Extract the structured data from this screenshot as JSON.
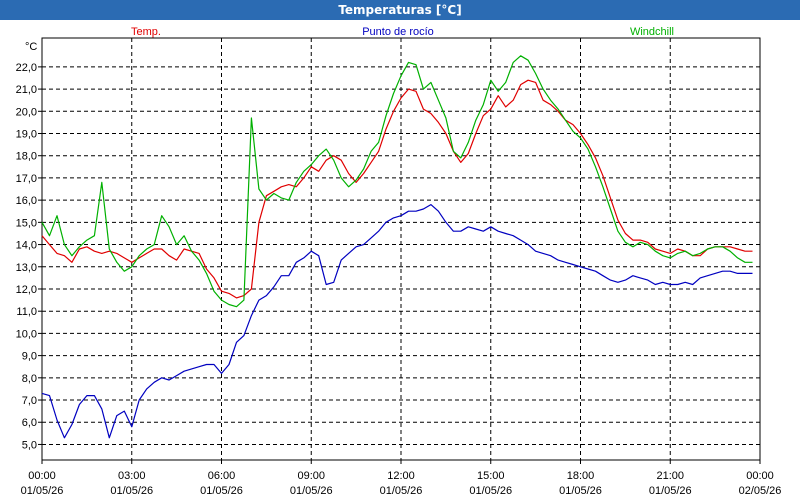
{
  "window": {
    "title": "Temperaturas [°C]"
  },
  "chart_data": {
    "type": "line",
    "title": "Temperaturas [°C]",
    "ylabel": "°C",
    "ylim": [
      4.3,
      23.3
    ],
    "yticks": [
      5.0,
      6.0,
      7.0,
      8.0,
      9.0,
      10.0,
      11.0,
      12.0,
      13.0,
      14.0,
      15.0,
      16.0,
      17.0,
      18.0,
      19.0,
      20.0,
      21.0,
      22.0
    ],
    "ytick_labels": [
      "5,0",
      "6,0",
      "7,0",
      "8,0",
      "9,0",
      "10,0",
      "11,0",
      "12,0",
      "13,0",
      "14,0",
      "15,0",
      "16,0",
      "17,0",
      "18,0",
      "19,0",
      "20,0",
      "21,0",
      "22,0"
    ],
    "xlim": [
      0,
      24
    ],
    "xticks": [
      0,
      3,
      6,
      9,
      12,
      15,
      18,
      21,
      24
    ],
    "xtick_labels": [
      {
        "time": "00:00",
        "date": "01/05/26"
      },
      {
        "time": "03:00",
        "date": "01/05/26"
      },
      {
        "time": "06:00",
        "date": "01/05/26"
      },
      {
        "time": "09:00",
        "date": "01/05/26"
      },
      {
        "time": "12:00",
        "date": "01/05/26"
      },
      {
        "time": "15:00",
        "date": "01/05/26"
      },
      {
        "time": "18:00",
        "date": "01/05/26"
      },
      {
        "time": "21:00",
        "date": "01/05/26"
      },
      {
        "time": "00:00",
        "date": "02/05/26"
      }
    ],
    "grid": true,
    "legend": "top",
    "series": [
      {
        "name": "Temp.",
        "color": "#e00000",
        "x": [
          0,
          0.25,
          0.5,
          0.75,
          1,
          1.25,
          1.5,
          1.75,
          2,
          2.25,
          2.5,
          2.75,
          3,
          3.25,
          3.5,
          3.75,
          4,
          4.25,
          4.5,
          4.75,
          5,
          5.25,
          5.5,
          5.75,
          6,
          6.25,
          6.5,
          6.75,
          7,
          7.25,
          7.5,
          7.75,
          8,
          8.25,
          8.5,
          8.75,
          9,
          9.25,
          9.5,
          9.75,
          10,
          10.25,
          10.5,
          10.75,
          11,
          11.25,
          11.5,
          11.75,
          12,
          12.25,
          12.5,
          12.75,
          13,
          13.25,
          13.5,
          13.75,
          14,
          14.25,
          14.5,
          14.75,
          15,
          15.25,
          15.5,
          15.75,
          16,
          16.25,
          16.5,
          16.75,
          17,
          17.25,
          17.5,
          17.75,
          18,
          18.25,
          18.5,
          18.75,
          19,
          19.25,
          19.5,
          19.75,
          20,
          20.25,
          20.5,
          20.75,
          21,
          21.25,
          21.5,
          21.75,
          22,
          22.25,
          22.5,
          22.75,
          23,
          23.25,
          23.5,
          23.75
        ],
        "y": [
          14.4,
          14.0,
          13.6,
          13.5,
          13.2,
          13.8,
          13.9,
          13.7,
          13.6,
          13.7,
          13.6,
          13.4,
          13.2,
          13.4,
          13.6,
          13.8,
          13.8,
          13.5,
          13.3,
          13.8,
          13.7,
          13.6,
          12.9,
          12.5,
          11.9,
          11.8,
          11.6,
          11.7,
          12.0,
          15.0,
          16.2,
          16.4,
          16.6,
          16.7,
          16.6,
          17.0,
          17.5,
          17.3,
          17.8,
          18.0,
          17.8,
          17.2,
          16.8,
          17.2,
          17.7,
          18.2,
          19.2,
          20.0,
          20.6,
          21.0,
          20.9,
          20.1,
          19.9,
          19.5,
          19.0,
          18.2,
          17.7,
          18.1,
          19.0,
          19.8,
          20.1,
          20.7,
          20.2,
          20.5,
          21.2,
          21.4,
          21.3,
          20.5,
          20.3,
          20.0,
          19.6,
          19.4,
          19.0,
          18.5,
          17.9,
          17.1,
          16.1,
          15.1,
          14.5,
          14.2,
          14.2,
          14.1,
          13.8,
          13.7,
          13.6,
          13.8,
          13.7,
          13.5,
          13.5,
          13.8,
          13.9,
          13.9,
          13.9,
          13.8,
          13.7,
          13.7
        ]
      },
      {
        "name": "Punto de rocío",
        "color": "#0000c0",
        "x": [
          0,
          0.25,
          0.5,
          0.75,
          1,
          1.25,
          1.5,
          1.75,
          2,
          2.25,
          2.5,
          2.75,
          3,
          3.25,
          3.5,
          3.75,
          4,
          4.25,
          4.5,
          4.75,
          5,
          5.25,
          5.5,
          5.75,
          6,
          6.25,
          6.5,
          6.75,
          7,
          7.25,
          7.5,
          7.75,
          8,
          8.25,
          8.5,
          8.75,
          9,
          9.25,
          9.5,
          9.75,
          10,
          10.25,
          10.5,
          10.75,
          11,
          11.25,
          11.5,
          11.75,
          12,
          12.25,
          12.5,
          12.75,
          13,
          13.25,
          13.5,
          13.75,
          14,
          14.25,
          14.5,
          14.75,
          15,
          15.25,
          15.5,
          15.75,
          16,
          16.25,
          16.5,
          16.75,
          17,
          17.25,
          17.5,
          17.75,
          18,
          18.25,
          18.5,
          18.75,
          19,
          19.25,
          19.5,
          19.75,
          20,
          20.25,
          20.5,
          20.75,
          21,
          21.25,
          21.5,
          21.75,
          22,
          22.25,
          22.5,
          22.75,
          23,
          23.25,
          23.5,
          23.75
        ],
        "y": [
          7.3,
          7.2,
          6.1,
          5.3,
          5.9,
          6.8,
          7.2,
          7.2,
          6.6,
          5.3,
          6.3,
          6.5,
          5.8,
          7.0,
          7.5,
          7.8,
          8.0,
          7.9,
          8.1,
          8.3,
          8.4,
          8.5,
          8.6,
          8.6,
          8.2,
          8.6,
          9.6,
          9.9,
          10.8,
          11.5,
          11.7,
          12.1,
          12.6,
          12.6,
          13.2,
          13.4,
          13.7,
          13.5,
          12.2,
          12.3,
          13.3,
          13.6,
          13.9,
          14.0,
          14.3,
          14.6,
          15.0,
          15.2,
          15.3,
          15.5,
          15.5,
          15.6,
          15.8,
          15.5,
          15.0,
          14.6,
          14.6,
          14.8,
          14.7,
          14.6,
          14.8,
          14.6,
          14.5,
          14.4,
          14.2,
          14.0,
          13.7,
          13.6,
          13.5,
          13.3,
          13.2,
          13.1,
          13.0,
          12.9,
          12.8,
          12.6,
          12.4,
          12.3,
          12.4,
          12.6,
          12.5,
          12.4,
          12.2,
          12.3,
          12.2,
          12.2,
          12.3,
          12.2,
          12.5,
          12.6,
          12.7,
          12.8,
          12.8,
          12.7,
          12.7,
          12.7
        ]
      },
      {
        "name": "Windchill",
        "color": "#00b000",
        "x": [
          0,
          0.25,
          0.5,
          0.75,
          1,
          1.25,
          1.5,
          1.75,
          2,
          2.25,
          2.5,
          2.75,
          3,
          3.25,
          3.5,
          3.75,
          4,
          4.25,
          4.5,
          4.75,
          5,
          5.25,
          5.5,
          5.75,
          6,
          6.25,
          6.5,
          6.75,
          7,
          7.25,
          7.5,
          7.75,
          8,
          8.25,
          8.5,
          8.75,
          9,
          9.25,
          9.5,
          9.75,
          10,
          10.25,
          10.5,
          10.75,
          11,
          11.25,
          11.5,
          11.75,
          12,
          12.25,
          12.5,
          12.75,
          13,
          13.25,
          13.5,
          13.75,
          14,
          14.25,
          14.5,
          14.75,
          15,
          15.25,
          15.5,
          15.75,
          16,
          16.25,
          16.5,
          16.75,
          17,
          17.25,
          17.5,
          17.75,
          18,
          18.25,
          18.5,
          18.75,
          19,
          19.25,
          19.5,
          19.75,
          20,
          20.25,
          20.5,
          20.75,
          21,
          21.25,
          21.5,
          21.75,
          22,
          22.25,
          22.5,
          22.75,
          23,
          23.25,
          23.5,
          23.75
        ],
        "y": [
          15.0,
          14.4,
          15.3,
          14.0,
          13.5,
          13.9,
          14.2,
          14.4,
          16.8,
          13.8,
          13.2,
          12.8,
          13.0,
          13.5,
          13.8,
          14.0,
          15.3,
          14.8,
          14.0,
          14.4,
          13.7,
          13.3,
          12.7,
          11.9,
          11.5,
          11.3,
          11.2,
          11.5,
          19.7,
          16.5,
          16.0,
          16.3,
          16.1,
          16.0,
          16.8,
          17.3,
          17.6,
          18.0,
          18.3,
          17.8,
          17.0,
          16.6,
          16.9,
          17.4,
          18.2,
          18.6,
          19.8,
          20.8,
          21.6,
          22.2,
          22.1,
          21.0,
          21.3,
          20.5,
          19.7,
          18.2,
          17.9,
          18.6,
          19.6,
          20.3,
          21.4,
          20.9,
          21.3,
          22.2,
          22.5,
          22.3,
          21.7,
          21.0,
          20.5,
          20.1,
          19.6,
          19.1,
          18.8,
          18.3,
          17.5,
          16.6,
          15.6,
          14.6,
          14.1,
          13.9,
          14.1,
          14.0,
          13.7,
          13.5,
          13.4,
          13.6,
          13.7,
          13.5,
          13.6,
          13.8,
          13.9,
          13.9,
          13.7,
          13.4,
          13.2,
          13.2
        ]
      }
    ]
  }
}
